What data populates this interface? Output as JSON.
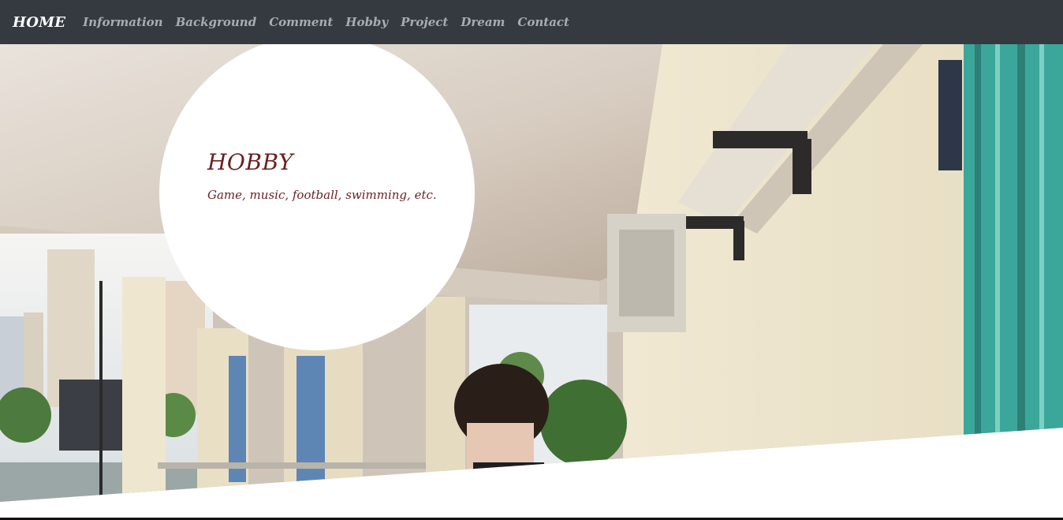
{
  "navbar": {
    "brand": "HOME",
    "items": [
      {
        "label": "Information"
      },
      {
        "label": "Background"
      },
      {
        "label": "Comment"
      },
      {
        "label": "Hobby"
      },
      {
        "label": "Project"
      },
      {
        "label": "Dream"
      },
      {
        "label": "Contact"
      }
    ]
  },
  "hero": {
    "title": "HOBBY",
    "text": "Game, music, football, swimming, etc."
  },
  "colors": {
    "navbar_bg": "#343a40",
    "accent_text": "#6b1f1f"
  }
}
